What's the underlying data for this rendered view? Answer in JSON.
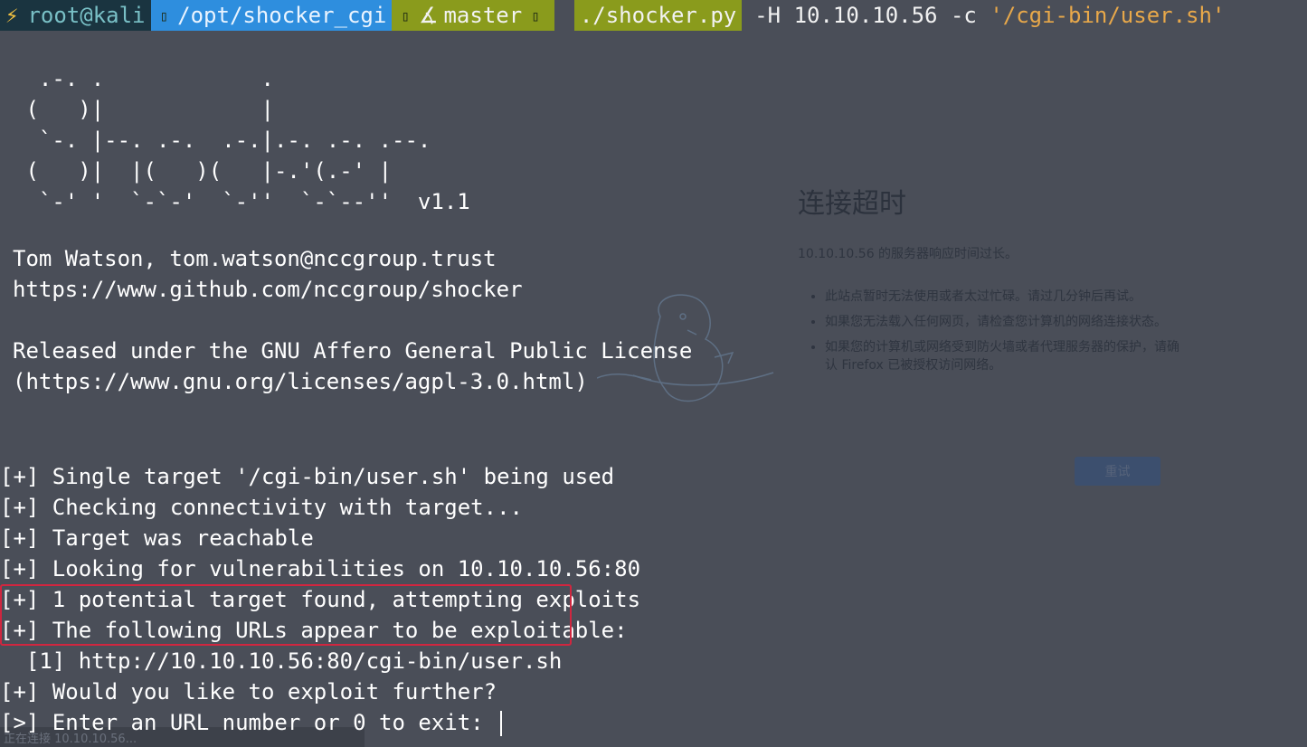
{
  "prompt": {
    "icon": "lightning-bolt-icon",
    "user": "root@kali",
    "path": "/opt/shocker_cgi",
    "branch": "master",
    "command": "./shocker.py",
    "args_plain": " -H 10.10.10.56 -c ",
    "args_quoted": "'/cgi-bin/user.sh'"
  },
  "banner": {
    "ascii_art": "  .-. .            .\n (   )|            |\n  `-. |--. .-.  .-.|.-. .-. .--.\n (   )|  |(   )(   |-.'(.-' |\n  `-' '  `-`-'  `-''  `-`--''  v1.1",
    "author": "Tom Watson, tom.watson@nccgroup.trust",
    "repo": "https://www.github.com/nccgroup/shocker",
    "license_line": "Released under the GNU Affero General Public License",
    "license_url": "(https://www.gnu.org/licenses/agpl-3.0.html)"
  },
  "log": [
    "[+] Single target '/cgi-bin/user.sh' being used",
    "[+] Checking connectivity with target...",
    "[+] Target was reachable",
    "[+] Looking for vulnerabilities on 10.10.10.56:80",
    "[+] 1 potential target found, attempting exploits",
    "[+] The following URLs appear to be exploitable:",
    "  [1] http://10.10.10.56:80/cgi-bin/user.sh",
    "[+] Would you like to exploit further?",
    "[>] Enter an URL number or 0 to exit: "
  ],
  "browser_error": {
    "title": "连接超时",
    "subtitle": "10.10.10.56 的服务器响应时间过长。",
    "tips": [
      "此站点暂时无法使用或者太过忙碌。请过几分钟后再试。",
      "如果您无法载入任何网页，请检查您计算机的网络连接状态。",
      "如果您的计算机或网络受到防火墙或者代理服务器的保护，请确认 Firefox 已被授权访问网络。"
    ],
    "retry_label": "重试",
    "status_text": "正在连接 10.10.10.56..."
  },
  "colors": {
    "background": "#4a4e58",
    "user_segment": "#1a3440",
    "path_segment": "#2e8ede",
    "git_segment": "#8a9b1c",
    "quoted_arg": "#e8a84a",
    "highlight_border": "#d0263f"
  }
}
